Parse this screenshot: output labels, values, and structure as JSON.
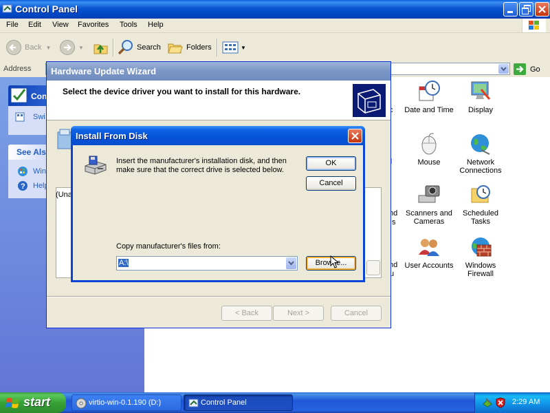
{
  "control_panel": {
    "title": "Control Panel",
    "menu": [
      "File",
      "Edit",
      "View",
      "Favorites",
      "Tools",
      "Help"
    ],
    "toolbar": {
      "back_label": "Back",
      "search_label": "Search",
      "folders_label": "Folders"
    },
    "address": {
      "label": "Address",
      "go_label": "Go"
    },
    "taskpane": {
      "panel_title_partial": "Con",
      "switch_partial": "Swi",
      "see_also_partial": "See Als",
      "windows_update_partial": "Win",
      "help_partial": "Help"
    },
    "icons": [
      {
        "label": "Date and Time",
        "icon": "clock-icon"
      },
      {
        "label": "Display",
        "icon": "display-icon"
      },
      {
        "label": "Mouse",
        "icon": "mouse-icon"
      },
      {
        "label": "Network Connections",
        "icon": "network-icon"
      },
      {
        "label": "Scanners and Cameras",
        "icon": "scanner-icon"
      },
      {
        "label": "Scheduled Tasks",
        "icon": "scheduled-tasks-icon"
      },
      {
        "label": "User Accounts",
        "icon": "user-accounts-icon"
      },
      {
        "label": "Windows Firewall",
        "icon": "firewall-icon"
      }
    ],
    "partial_labels": [
      "c",
      "d",
      "nd",
      "s",
      "nd",
      "u"
    ]
  },
  "wizard": {
    "title": "Hardware Update Wizard",
    "header_text": "Select the device driver you want to install for this hardware.",
    "list_partial": "(Una",
    "back_label": "< Back",
    "next_label": "Next >",
    "cancel_label": "Cancel"
  },
  "install_from_disk": {
    "title": "Install From Disk",
    "message": "Insert the manufacturer's installation disk, and then make sure that the correct drive is selected below.",
    "ok_label": "OK",
    "cancel_label": "Cancel",
    "copy_label": "Copy manufacturer's files from:",
    "combo_value": "A:\\",
    "browse_label": "Browse..."
  },
  "taskbar": {
    "start_label": "start",
    "tasks": [
      {
        "label": "virtio-win-0.1.190 (D:)",
        "active": false
      },
      {
        "label": "Control Panel",
        "active": true
      }
    ],
    "clock": "2:29 AM"
  }
}
